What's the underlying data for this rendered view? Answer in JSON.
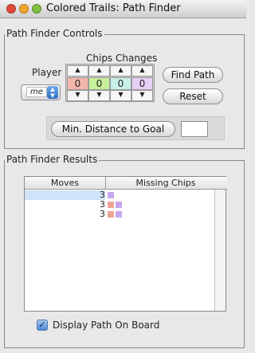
{
  "window": {
    "title": "Colored Trails: Path Finder"
  },
  "controls": {
    "group_title": "Path Finder Controls",
    "player_label": "Player",
    "player_value": "me",
    "chips_changes_label": "Chips Changes",
    "chips": [
      {
        "value": "0",
        "color": "#f3b6ac"
      },
      {
        "value": "0",
        "color": "#c7ef9b"
      },
      {
        "value": "0",
        "color": "#c7f0ea"
      },
      {
        "value": "0",
        "color": "#e6d0f5"
      }
    ],
    "up_symbol": "▲",
    "down_symbol": "▼",
    "find_path": "Find Path",
    "reset": "Reset",
    "min_distance": "Min. Distance to Goal",
    "min_distance_value": ""
  },
  "results": {
    "group_title": "Path Finder Results",
    "columns": [
      "Moves",
      "Missing Chips"
    ],
    "rows": [
      {
        "moves": "3",
        "chips": [
          "#c6a7ef"
        ],
        "selected": true
      },
      {
        "moves": "3",
        "chips": [
          "#f0a497",
          "#c6a7ef"
        ],
        "selected": false
      },
      {
        "moves": "3",
        "chips": [
          "#f0a497",
          "#c6a7ef"
        ],
        "selected": false
      }
    ],
    "display_checkbox": {
      "label": "Display Path On Board",
      "checked": true,
      "check_symbol": "✓"
    }
  }
}
